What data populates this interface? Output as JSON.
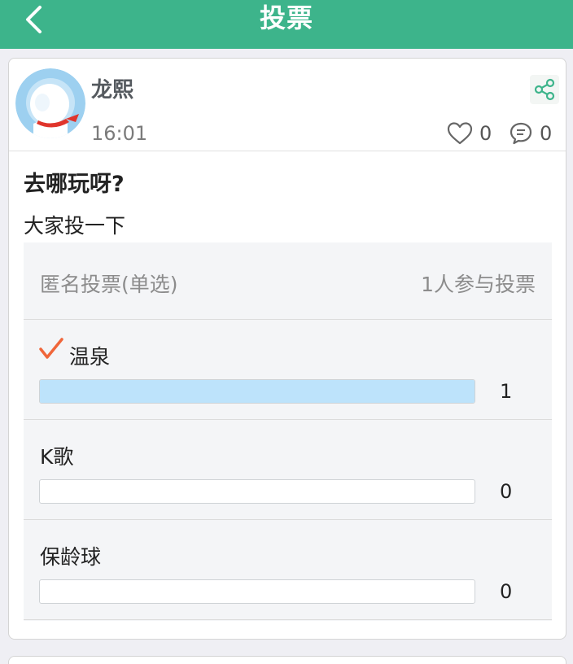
{
  "header": {
    "title": "投票",
    "background": "#3db48b"
  },
  "post": {
    "author": "龙熙",
    "time": "16:01",
    "likes": "0",
    "comments": "0",
    "title": "去哪玩呀?",
    "body": "大家投一下"
  },
  "poll": {
    "type_label": "匿名投票(单选)",
    "participants_label": "1人参与投票",
    "options": [
      {
        "label": "温泉",
        "count": "1",
        "selected": true,
        "fill_fraction": 1.0
      },
      {
        "label": "K歌",
        "count": "0",
        "selected": false,
        "fill_fraction": 0.0
      },
      {
        "label": "保龄球",
        "count": "0",
        "selected": false,
        "fill_fraction": 0.0
      }
    ],
    "bar_fill_color": "#bde3fb",
    "check_color": "#f0663a"
  },
  "icons": {
    "back": "chevron-left-icon",
    "share": "share-icon",
    "like": "heart-icon",
    "comment": "comment-icon",
    "check": "check-icon"
  }
}
